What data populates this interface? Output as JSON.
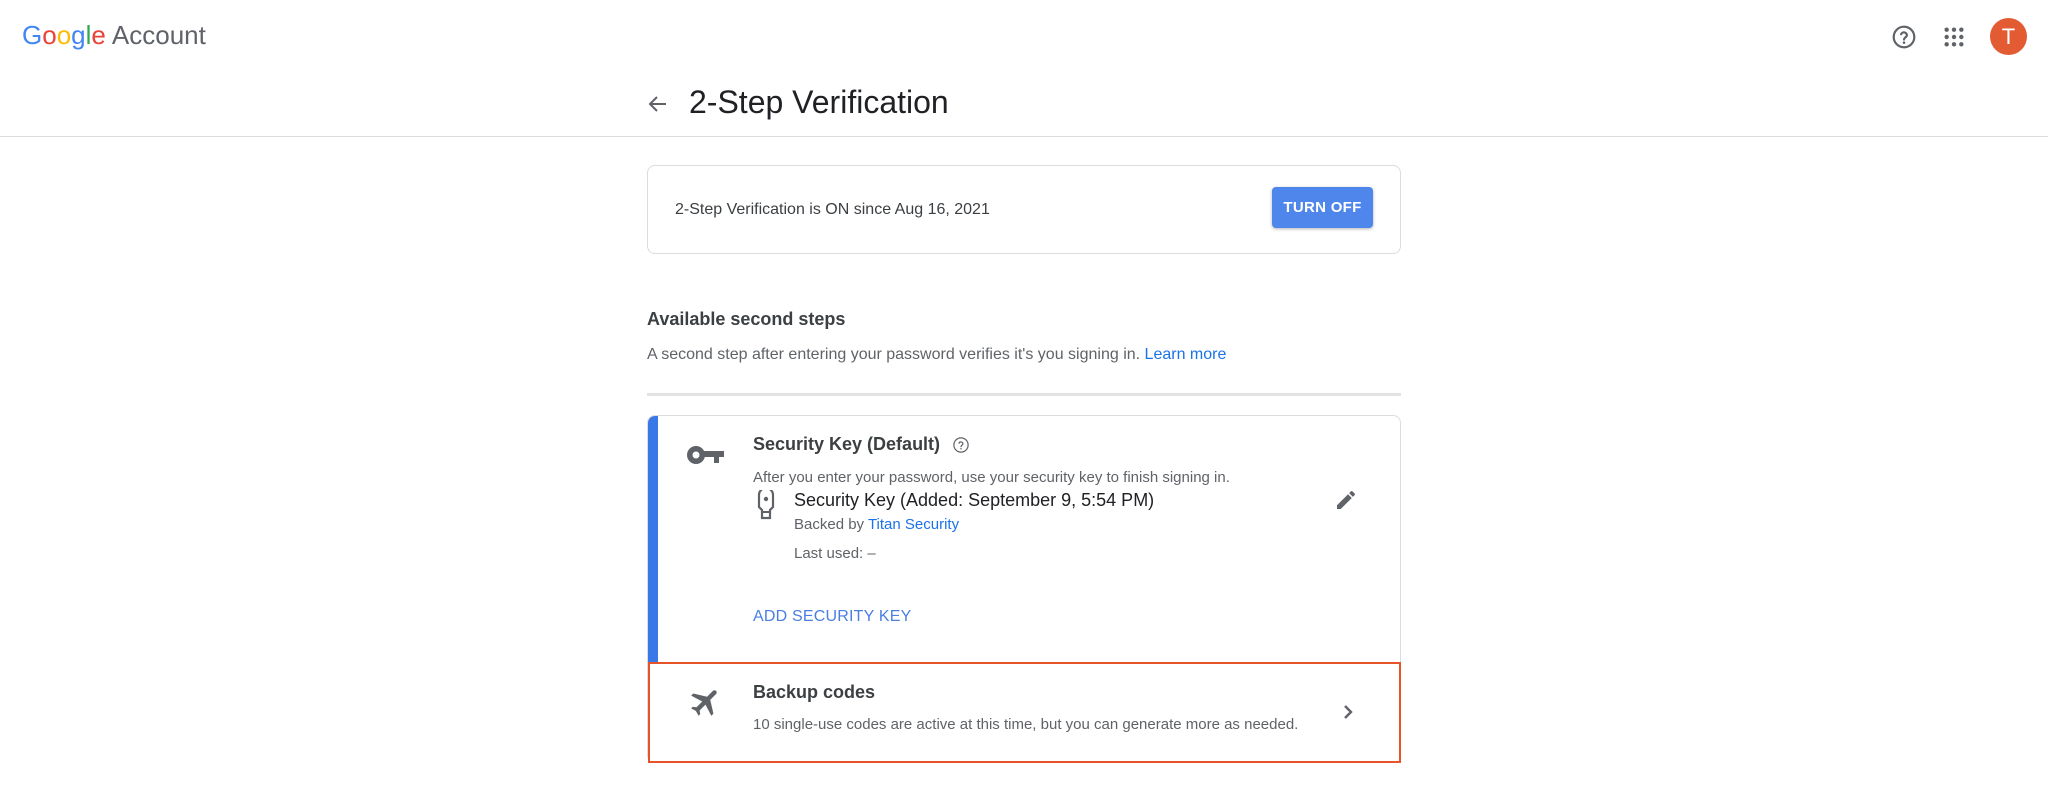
{
  "header": {
    "logo_letters": [
      {
        "char": "G",
        "color": "#4285F4"
      },
      {
        "char": "o",
        "color": "#EA4335"
      },
      {
        "char": "o",
        "color": "#FBBC05"
      },
      {
        "char": "g",
        "color": "#4285F4"
      },
      {
        "char": "l",
        "color": "#34A853"
      },
      {
        "char": "e",
        "color": "#EA4335"
      }
    ],
    "logo_suffix": "Account",
    "help_icon": "help-circle-icon",
    "apps_icon": "apps-grid-icon",
    "avatar_initial": "T",
    "avatar_color": "#E25B33"
  },
  "page": {
    "back_icon": "arrow-back-icon",
    "title": "2-Step Verification"
  },
  "status": {
    "text": "2-Step Verification is ON since Aug 16, 2021",
    "turn_off_label": "TURN OFF",
    "button_color": "#4F86EC"
  },
  "second_steps": {
    "title": "Available second steps",
    "description": "A second step after entering your password verifies it's you signing in.",
    "learn_more": "Learn more"
  },
  "security_key": {
    "icon": "key-icon",
    "title": "Security Key (Default)",
    "help_icon": "help-circle-icon",
    "description": "After you enter your password, use your security key to finish signing in.",
    "accent_color": "#3B78E7",
    "device": {
      "icon": "usb-security-key-icon",
      "name": "Security Key (Added: September 9, 5:54 PM)",
      "backed_by_prefix": "Backed by",
      "backed_by_link": "Titan Security",
      "last_used": "Last used: –"
    },
    "edit_icon": "pencil-icon",
    "add_label": "ADD SECURITY KEY"
  },
  "backup_codes": {
    "icon": "airplane-icon",
    "title": "Backup codes",
    "description": "10 single-use codes are active at this time, but you can generate more as needed.",
    "chevron_icon": "chevron-right-icon",
    "highlight_color": "#E8542A"
  }
}
